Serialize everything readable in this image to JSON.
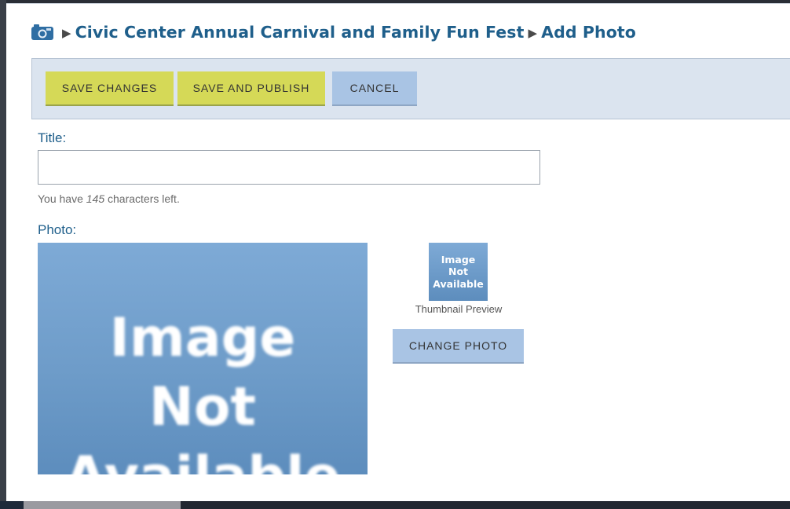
{
  "header": {
    "icon": "camera-icon",
    "separator": "▶",
    "event_name": "Civic Center Annual Carnival and Family Fun Fest",
    "page_name": "Add Photo"
  },
  "toolbar": {
    "save_label": "SAVE CHANGES",
    "publish_label": "SAVE AND PUBLISH",
    "cancel_label": "CANCEL"
  },
  "form": {
    "title_label": "Title:",
    "title_value": "",
    "title_placeholder": "",
    "chars_prefix": "You have",
    "chars_count": "145",
    "chars_suffix": "characters left.",
    "photo_label": "Photo:",
    "photo_line1": "Image",
    "photo_line2": "Not",
    "photo_line3": "Available",
    "thumb_line1": "Image",
    "thumb_line2": "Not",
    "thumb_line3": "Available",
    "thumbnail_caption": "Thumbnail Preview",
    "change_photo_label": "CHANGE PHOTO"
  },
  "colors": {
    "heading": "#1f5f8b",
    "button_yellow": "#d5d957",
    "button_blue": "#a9c4e4",
    "toolbar_bg": "#dbe4ef",
    "placeholder_image": "#6e9cc9"
  }
}
